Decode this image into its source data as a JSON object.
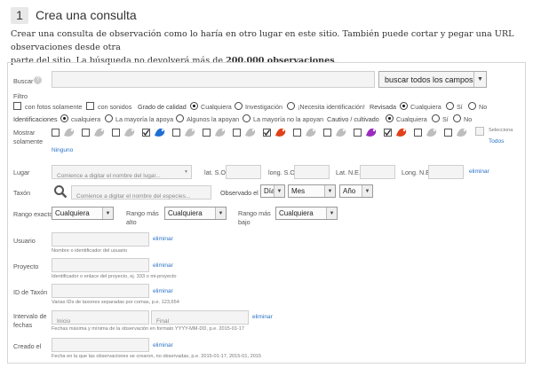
{
  "header": {
    "step": "1",
    "title": "Crea una consulta"
  },
  "intro": {
    "line1": "Crear una consulta de observación como lo haría en otro lugar en este sitio. También puede cortar y pegar una URL observaciones desde otra",
    "line2_pre": "parte del sitio. La búsqueda no devolverá más de ",
    "line2_bold": "200.000 observaciones",
    "line2_post": "."
  },
  "search": {
    "label": "Buscar",
    "value": "",
    "scope_button": "buscar todos los campos"
  },
  "filters": {
    "label": "Filtro",
    "photos_only": "con fotos solamente",
    "with_sounds": "con sonidos",
    "quality_label": "Grado de calidad",
    "quality_options": [
      "Cualquiera",
      "Investigación",
      "¡Necesita identificación!"
    ],
    "reviewed_label": "Revisada",
    "reviewed_options": [
      "Cualquiera",
      "Sí",
      "No"
    ],
    "ident_label": "Identificaciones",
    "ident_options": [
      "cualquiera",
      "La mayoría la apoya",
      "Algunos la apoyan",
      "La mayoría no la apoyan"
    ],
    "captive_label": "Cautivo / cultivado",
    "captive_options": [
      "Cualquiera",
      "Sí",
      "No"
    ]
  },
  "show_only": {
    "label_1": "Mostrar",
    "label_2": "solamente",
    "select_label": "Selecciona",
    "all_link": "Todos",
    "none_link": "Ninguno",
    "taxa": [
      {
        "icon": "plant-icon",
        "checked": false,
        "color": "#bdbdbd"
      },
      {
        "icon": "insect-icon",
        "checked": false,
        "color": "#bdbdbd"
      },
      {
        "icon": "bird-icon",
        "checked": false,
        "color": "#bdbdbd"
      },
      {
        "icon": "amphibian-icon",
        "checked": true,
        "color": "#1f6fd1"
      },
      {
        "icon": "reptile-icon",
        "checked": false,
        "color": "#bdbdbd"
      },
      {
        "icon": "mammal-icon",
        "checked": false,
        "color": "#bdbdbd"
      },
      {
        "icon": "arachnid-icon",
        "checked": false,
        "color": "#bdbdbd"
      },
      {
        "icon": "fish-icon",
        "checked": true,
        "color": "#e0401a"
      },
      {
        "icon": "mollusk-icon",
        "checked": false,
        "color": "#bdbdbd"
      },
      {
        "icon": "protozoa-icon",
        "checked": false,
        "color": "#bdbdbd"
      },
      {
        "icon": "chromista-icon",
        "checked": false,
        "color": "#9b2bbd"
      },
      {
        "icon": "fungi-icon",
        "checked": true,
        "color": "#e0401a"
      },
      {
        "icon": "animalia-icon",
        "checked": false,
        "color": "#bdbdbd"
      },
      {
        "icon": "unknown-icon",
        "checked": false,
        "color": "#bdbdbd"
      }
    ]
  },
  "place": {
    "label": "Lugar",
    "placeholder": "Comience a digitar el nombre del lugar...",
    "lat_so": "lat. S.O.",
    "long_so": "long. S.O.",
    "lat_ne": "Lat. N.E.",
    "long_ne": "Long. N.E.",
    "remove": "eliminar"
  },
  "taxon": {
    "label": "Taxón",
    "placeholder": "Comience a digitar el nombre del especies...",
    "observed_label": "Observado el",
    "day": "Día",
    "month": "Mes",
    "year": "Año"
  },
  "rank": {
    "exact_label": "Rango exacto",
    "exact_value": "Cualquiera",
    "high_label_1": "Rango más",
    "high_label_2": "alto",
    "high_value": "Cualquiera",
    "low_label_1": "Rango más",
    "low_label_2": "bajo",
    "low_value": "Cualquiera"
  },
  "user": {
    "label": "Usuario",
    "remove": "eliminar",
    "hint": "Nombre o identificador del usuario"
  },
  "project": {
    "label": "Proyecto",
    "remove": "eliminar",
    "hint": "Identificador o enlace del proyecto, ej. 333 o mi-proyecto"
  },
  "taxon_id": {
    "label": "ID de Taxón",
    "remove": "eliminar",
    "hint": "Varias IDs de taxones separadas por comas, p.e. 123,654"
  },
  "date_range": {
    "label_1": "Intervalo de",
    "label_2": "fechas",
    "start": "Inicio",
    "end": "Final",
    "remove": "eliminar",
    "hint": "Fechas máxima y mínima de la observación en formato YYYY-MM-DD, p.e. 2015-01-17"
  },
  "created": {
    "label": "Creado el",
    "remove": "eliminar",
    "hint": "Fecha en la que las observaciones se crearon, no observadas, p.e. 2015-01-17, 2015-01, 2015"
  }
}
